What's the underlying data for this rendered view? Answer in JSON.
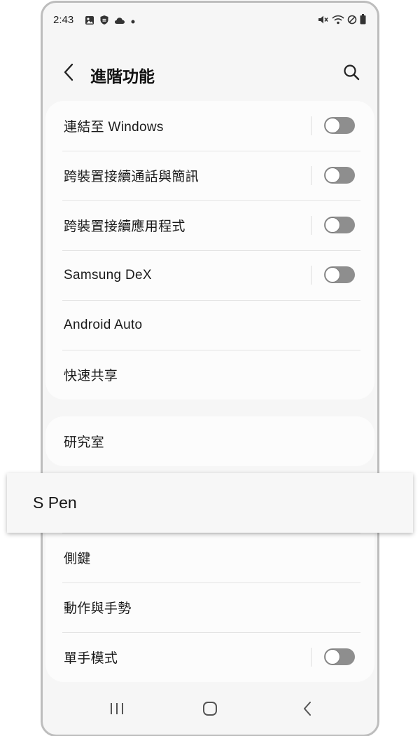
{
  "status_bar": {
    "time": "2:43",
    "left_icons": [
      "gallery-icon",
      "shield-icon",
      "cloud-icon",
      "dot-icon"
    ],
    "right_icons": [
      "mute-icon",
      "wifi-icon",
      "do-not-disturb-icon",
      "battery-icon"
    ]
  },
  "header": {
    "title": "進階功能",
    "back_icon": "chevron-left-icon",
    "search_icon": "search-icon"
  },
  "group1": [
    {
      "label": "連結至 Windows",
      "toggle": false
    },
    {
      "label": "跨裝置接續通話與簡訊",
      "toggle": false
    },
    {
      "label": "跨裝置接續應用程式",
      "toggle": false
    },
    {
      "label": "Samsung DeX",
      "toggle": false
    },
    {
      "label": "Android Auto"
    },
    {
      "label": "快速共享"
    }
  ],
  "group2": [
    {
      "label": "研究室"
    }
  ],
  "highlight": {
    "label": "S Pen"
  },
  "group3": [
    {
      "label": "側鍵"
    },
    {
      "label": "動作與手勢"
    },
    {
      "label": "單手模式",
      "toggle": false
    }
  ],
  "nav_bar": {
    "recents_icon": "recents-icon",
    "home_icon": "home-icon",
    "back_icon": "back-icon"
  },
  "colors": {
    "background": "#f6f6f6",
    "card": "#fcfcfc",
    "toggle_off": "#8e8e8e",
    "frame": "#bdbdbd"
  }
}
